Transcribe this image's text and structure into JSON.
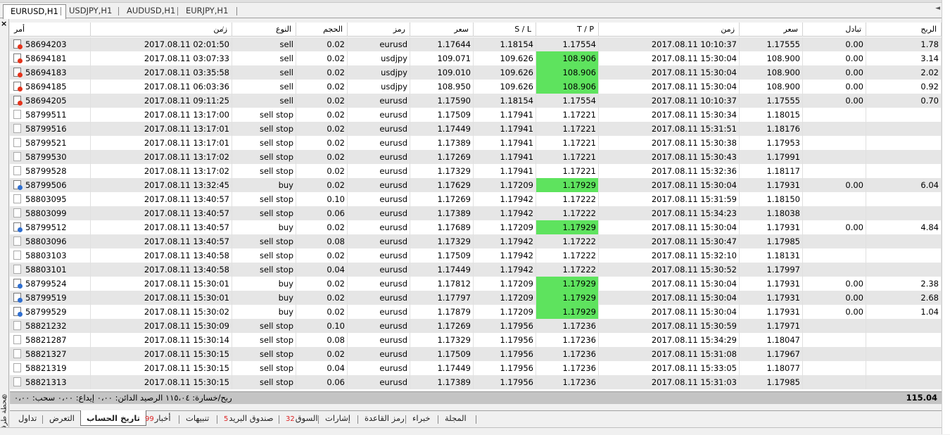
{
  "chart_tabs": [
    {
      "label": "EURUSD,H1",
      "active": true
    },
    {
      "label": "USDJPY,H1",
      "active": false
    },
    {
      "label": "AUDUSD,H1",
      "active": false
    },
    {
      "label": "EURJPY,H1",
      "active": false
    }
  ],
  "side_panel_title": "محطة طرفية",
  "columns": {
    "order": "أمر",
    "open_time": "زمن",
    "type": "النوع",
    "volume": "الحجم",
    "symbol": "رمز",
    "open_price": "سعر",
    "sl": "S / L",
    "tp": "T / P",
    "close_time": "زمن",
    "close_price": "سعر",
    "swap": "تبادل",
    "profit": "الربح"
  },
  "rows": [
    {
      "order": "58694203",
      "open_time": "2017.08.11 02:01:50",
      "type": "sell",
      "volume": "0.02",
      "symbol": "eurusd",
      "open_price": "1.17644",
      "sl": "1.18154",
      "tp": "1.17554",
      "tp_hit": false,
      "close_time": "2017.08.11 10:10:37",
      "close_price": "1.17555",
      "swap": "0.00",
      "profit": "1.78",
      "icon": "sell"
    },
    {
      "order": "58694181",
      "open_time": "2017.08.11 03:07:33",
      "type": "sell",
      "volume": "0.02",
      "symbol": "usdjpy",
      "open_price": "109.071",
      "sl": "109.626",
      "tp": "108.906",
      "tp_hit": true,
      "close_time": "2017.08.11 15:30:04",
      "close_price": "108.900",
      "swap": "0.00",
      "profit": "3.14",
      "icon": "sell"
    },
    {
      "order": "58694183",
      "open_time": "2017.08.11 03:35:58",
      "type": "sell",
      "volume": "0.02",
      "symbol": "usdjpy",
      "open_price": "109.010",
      "sl": "109.626",
      "tp": "108.906",
      "tp_hit": true,
      "close_time": "2017.08.11 15:30:04",
      "close_price": "108.900",
      "swap": "0.00",
      "profit": "2.02",
      "icon": "sell"
    },
    {
      "order": "58694185",
      "open_time": "2017.08.11 06:03:36",
      "type": "sell",
      "volume": "0.02",
      "symbol": "usdjpy",
      "open_price": "108.950",
      "sl": "109.626",
      "tp": "108.906",
      "tp_hit": true,
      "close_time": "2017.08.11 15:30:04",
      "close_price": "108.900",
      "swap": "0.00",
      "profit": "0.92",
      "icon": "sell"
    },
    {
      "order": "58694205",
      "open_time": "2017.08.11 09:11:25",
      "type": "sell",
      "volume": "0.02",
      "symbol": "eurusd",
      "open_price": "1.17590",
      "sl": "1.18154",
      "tp": "1.17554",
      "tp_hit": false,
      "close_time": "2017.08.11 10:10:37",
      "close_price": "1.17555",
      "swap": "0.00",
      "profit": "0.70",
      "icon": "sell"
    },
    {
      "order": "58799511",
      "open_time": "2017.08.11 13:17:00",
      "type": "sell stop",
      "volume": "0.02",
      "symbol": "eurusd",
      "open_price": "1.17509",
      "sl": "1.17941",
      "tp": "1.17221",
      "tp_hit": false,
      "close_time": "2017.08.11 15:30:34",
      "close_price": "1.18015",
      "swap": "",
      "profit": "",
      "icon": "pending"
    },
    {
      "order": "58799516",
      "open_time": "2017.08.11 13:17:01",
      "type": "sell stop",
      "volume": "0.02",
      "symbol": "eurusd",
      "open_price": "1.17449",
      "sl": "1.17941",
      "tp": "1.17221",
      "tp_hit": false,
      "close_time": "2017.08.11 15:31:51",
      "close_price": "1.18176",
      "swap": "",
      "profit": "",
      "icon": "pending"
    },
    {
      "order": "58799521",
      "open_time": "2017.08.11 13:17:01",
      "type": "sell stop",
      "volume": "0.02",
      "symbol": "eurusd",
      "open_price": "1.17389",
      "sl": "1.17941",
      "tp": "1.17221",
      "tp_hit": false,
      "close_time": "2017.08.11 15:30:38",
      "close_price": "1.17953",
      "swap": "",
      "profit": "",
      "icon": "pending"
    },
    {
      "order": "58799530",
      "open_time": "2017.08.11 13:17:02",
      "type": "sell stop",
      "volume": "0.02",
      "symbol": "eurusd",
      "open_price": "1.17269",
      "sl": "1.17941",
      "tp": "1.17221",
      "tp_hit": false,
      "close_time": "2017.08.11 15:30:43",
      "close_price": "1.17991",
      "swap": "",
      "profit": "",
      "icon": "pending"
    },
    {
      "order": "58799528",
      "open_time": "2017.08.11 13:17:02",
      "type": "sell stop",
      "volume": "0.02",
      "symbol": "eurusd",
      "open_price": "1.17329",
      "sl": "1.17941",
      "tp": "1.17221",
      "tp_hit": false,
      "close_time": "2017.08.11 15:32:36",
      "close_price": "1.18117",
      "swap": "",
      "profit": "",
      "icon": "pending"
    },
    {
      "order": "58799506",
      "open_time": "2017.08.11 13:32:45",
      "type": "buy",
      "volume": "0.02",
      "symbol": "eurusd",
      "open_price": "1.17629",
      "sl": "1.17209",
      "tp": "1.17929",
      "tp_hit": true,
      "close_time": "2017.08.11 15:30:04",
      "close_price": "1.17931",
      "swap": "0.00",
      "profit": "6.04",
      "icon": "buy"
    },
    {
      "order": "58803095",
      "open_time": "2017.08.11 13:40:57",
      "type": "sell stop",
      "volume": "0.10",
      "symbol": "eurusd",
      "open_price": "1.17269",
      "sl": "1.17942",
      "tp": "1.17222",
      "tp_hit": false,
      "close_time": "2017.08.11 15:31:59",
      "close_price": "1.18150",
      "swap": "",
      "profit": "",
      "icon": "pending"
    },
    {
      "order": "58803099",
      "open_time": "2017.08.11 13:40:57",
      "type": "sell stop",
      "volume": "0.06",
      "symbol": "eurusd",
      "open_price": "1.17389",
      "sl": "1.17942",
      "tp": "1.17222",
      "tp_hit": false,
      "close_time": "2017.08.11 15:34:23",
      "close_price": "1.18038",
      "swap": "",
      "profit": "",
      "icon": "pending"
    },
    {
      "order": "58799512",
      "open_time": "2017.08.11 13:40:57",
      "type": "buy",
      "volume": "0.02",
      "symbol": "eurusd",
      "open_price": "1.17689",
      "sl": "1.17209",
      "tp": "1.17929",
      "tp_hit": true,
      "close_time": "2017.08.11 15:30:04",
      "close_price": "1.17931",
      "swap": "0.00",
      "profit": "4.84",
      "icon": "buy"
    },
    {
      "order": "58803096",
      "open_time": "2017.08.11 13:40:57",
      "type": "sell stop",
      "volume": "0.08",
      "symbol": "eurusd",
      "open_price": "1.17329",
      "sl": "1.17942",
      "tp": "1.17222",
      "tp_hit": false,
      "close_time": "2017.08.11 15:30:47",
      "close_price": "1.17985",
      "swap": "",
      "profit": "",
      "icon": "pending"
    },
    {
      "order": "58803103",
      "open_time": "2017.08.11 13:40:58",
      "type": "sell stop",
      "volume": "0.02",
      "symbol": "eurusd",
      "open_price": "1.17509",
      "sl": "1.17942",
      "tp": "1.17222",
      "tp_hit": false,
      "close_time": "2017.08.11 15:32:10",
      "close_price": "1.18131",
      "swap": "",
      "profit": "",
      "icon": "pending"
    },
    {
      "order": "58803101",
      "open_time": "2017.08.11 13:40:58",
      "type": "sell stop",
      "volume": "0.04",
      "symbol": "eurusd",
      "open_price": "1.17449",
      "sl": "1.17942",
      "tp": "1.17222",
      "tp_hit": false,
      "close_time": "2017.08.11 15:30:52",
      "close_price": "1.17997",
      "swap": "",
      "profit": "",
      "icon": "pending"
    },
    {
      "order": "58799524",
      "open_time": "2017.08.11 15:30:01",
      "type": "buy",
      "volume": "0.02",
      "symbol": "eurusd",
      "open_price": "1.17812",
      "sl": "1.17209",
      "tp": "1.17929",
      "tp_hit": true,
      "close_time": "2017.08.11 15:30:04",
      "close_price": "1.17931",
      "swap": "0.00",
      "profit": "2.38",
      "icon": "buy"
    },
    {
      "order": "58799519",
      "open_time": "2017.08.11 15:30:01",
      "type": "buy",
      "volume": "0.02",
      "symbol": "eurusd",
      "open_price": "1.17797",
      "sl": "1.17209",
      "tp": "1.17929",
      "tp_hit": true,
      "close_time": "2017.08.11 15:30:04",
      "close_price": "1.17931",
      "swap": "0.00",
      "profit": "2.68",
      "icon": "buy"
    },
    {
      "order": "58799529",
      "open_time": "2017.08.11 15:30:02",
      "type": "buy",
      "volume": "0.02",
      "symbol": "eurusd",
      "open_price": "1.17879",
      "sl": "1.17209",
      "tp": "1.17929",
      "tp_hit": true,
      "close_time": "2017.08.11 15:30:04",
      "close_price": "1.17931",
      "swap": "0.00",
      "profit": "1.04",
      "icon": "buy"
    },
    {
      "order": "58821232",
      "open_time": "2017.08.11 15:30:09",
      "type": "sell stop",
      "volume": "0.10",
      "symbol": "eurusd",
      "open_price": "1.17269",
      "sl": "1.17956",
      "tp": "1.17236",
      "tp_hit": false,
      "close_time": "2017.08.11 15:30:59",
      "close_price": "1.17971",
      "swap": "",
      "profit": "",
      "icon": "pending"
    },
    {
      "order": "58821287",
      "open_time": "2017.08.11 15:30:14",
      "type": "sell stop",
      "volume": "0.08",
      "symbol": "eurusd",
      "open_price": "1.17329",
      "sl": "1.17956",
      "tp": "1.17236",
      "tp_hit": false,
      "close_time": "2017.08.11 15:34:29",
      "close_price": "1.18047",
      "swap": "",
      "profit": "",
      "icon": "pending"
    },
    {
      "order": "58821327",
      "open_time": "2017.08.11 15:30:15",
      "type": "sell stop",
      "volume": "0.02",
      "symbol": "eurusd",
      "open_price": "1.17509",
      "sl": "1.17956",
      "tp": "1.17236",
      "tp_hit": false,
      "close_time": "2017.08.11 15:31:08",
      "close_price": "1.17967",
      "swap": "",
      "profit": "",
      "icon": "pending"
    },
    {
      "order": "58821319",
      "open_time": "2017.08.11 15:30:15",
      "type": "sell stop",
      "volume": "0.04",
      "symbol": "eurusd",
      "open_price": "1.17449",
      "sl": "1.17956",
      "tp": "1.17236",
      "tp_hit": false,
      "close_time": "2017.08.11 15:33:05",
      "close_price": "1.18077",
      "swap": "",
      "profit": "",
      "icon": "pending"
    },
    {
      "order": "58821313",
      "open_time": "2017.08.11 15:30:15",
      "type": "sell stop",
      "volume": "0.06",
      "symbol": "eurusd",
      "open_price": "1.17389",
      "sl": "1.17956",
      "tp": "1.17236",
      "tp_hit": false,
      "close_time": "2017.08.11 15:31:03",
      "close_price": "1.17985",
      "swap": "",
      "profit": "",
      "icon": "pending"
    }
  ],
  "summary": {
    "text": "ربح/خسارة: ١١٥،٠٤  الرصيد الدائن: ٠،٠٠  إيداع: ٠،٠٠  سحب: ٠،٠٠",
    "total": "115.04"
  },
  "bottom_tabs": [
    {
      "label": "تداول",
      "badge": "",
      "active": false
    },
    {
      "label": "التعرض",
      "badge": "",
      "active": false
    },
    {
      "label": "تاريخ الحساب",
      "badge": "",
      "active": true
    },
    {
      "label": "أخبار",
      "badge": "99",
      "active": false
    },
    {
      "label": "تنبيهات",
      "badge": "",
      "active": false
    },
    {
      "label": "صندوق البريد",
      "badge": "5",
      "active": false
    },
    {
      "label": "السوق",
      "badge": "32",
      "active": false
    },
    {
      "label": "إشارات",
      "badge": "",
      "active": false
    },
    {
      "label": "رمز القاعدة",
      "badge": "",
      "active": false
    },
    {
      "label": "خبراء",
      "badge": "",
      "active": false
    },
    {
      "label": "المجلة",
      "badge": "",
      "active": false
    }
  ],
  "colors": {
    "tp_hit": "#5ee35e",
    "sell_icon": "#e5331b",
    "buy_icon": "#2f6fd1",
    "row_alt": "#e6e6e6"
  }
}
